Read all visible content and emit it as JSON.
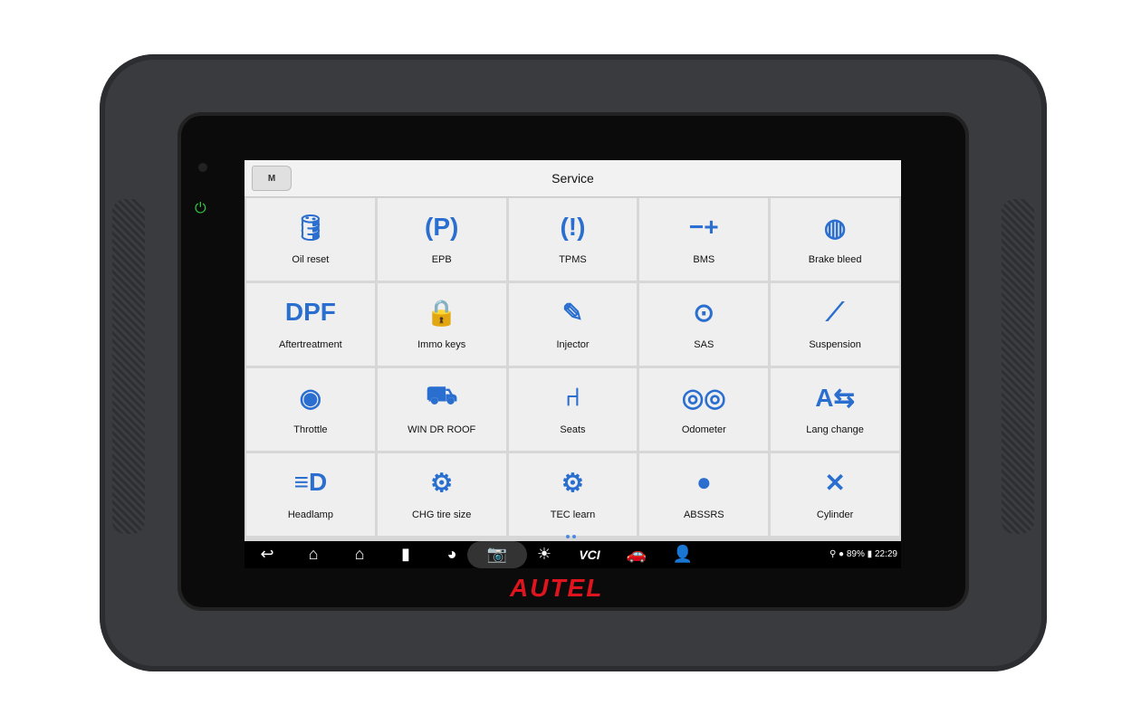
{
  "header": {
    "back_label": "M",
    "title": "Service"
  },
  "accent": "#2a6fd0",
  "tiles": [
    {
      "label": "Oil reset",
      "icon": "oil-can-icon",
      "glyph": "🛢"
    },
    {
      "label": "EPB",
      "icon": "parking-brake-icon",
      "glyph": "(P)"
    },
    {
      "label": "TPMS",
      "icon": "tire-pressure-icon",
      "glyph": "(!)"
    },
    {
      "label": "BMS",
      "icon": "battery-icon",
      "glyph": "−+"
    },
    {
      "label": "Brake bleed",
      "icon": "brake-icon",
      "glyph": "◍"
    },
    {
      "label": "Aftertreatment",
      "icon": "dpf-scr-icon",
      "glyph": "DPF"
    },
    {
      "label": "Immo keys",
      "icon": "key-lock-icon",
      "glyph": "🔒"
    },
    {
      "label": "Injector",
      "icon": "injector-icon",
      "glyph": "✎"
    },
    {
      "label": "SAS",
      "icon": "steering-wheel-icon",
      "glyph": "⊙"
    },
    {
      "label": "Suspension",
      "icon": "shock-absorber-icon",
      "glyph": "⟋"
    },
    {
      "label": "Throttle",
      "icon": "throttle-icon",
      "glyph": "◉"
    },
    {
      "label": "WIN DR ROOF",
      "icon": "car-top-icon",
      "glyph": "⛟"
    },
    {
      "label": "Seats",
      "icon": "seat-icon",
      "glyph": "⑁"
    },
    {
      "label": "Odometer",
      "icon": "odometer-icon",
      "glyph": "◎◎"
    },
    {
      "label": "Lang change",
      "icon": "language-icon",
      "glyph": "A⇆"
    },
    {
      "label": "Headlamp",
      "icon": "headlamp-icon",
      "glyph": "≡D"
    },
    {
      "label": "CHG tire size",
      "icon": "tire-icon",
      "glyph": "⚙"
    },
    {
      "label": "TEC learn",
      "icon": "gear-learn-icon",
      "glyph": "⚙"
    },
    {
      "label": "ABSSRS",
      "icon": "airbag-icon",
      "glyph": "●"
    },
    {
      "label": "Cylinder",
      "icon": "piston-icon",
      "glyph": "✕"
    }
  ],
  "navbar": {
    "buttons": [
      {
        "icon": "back-arrow-icon",
        "glyph": "↩"
      },
      {
        "icon": "home-icon",
        "glyph": "⌂"
      },
      {
        "icon": "android-home-icon",
        "glyph": "⌂"
      },
      {
        "icon": "recent-apps-icon",
        "glyph": "▮"
      },
      {
        "icon": "browser-icon",
        "glyph": "◕"
      },
      {
        "icon": "camera-icon",
        "glyph": "📷"
      },
      {
        "icon": "brightness-volume-icon",
        "glyph": "☀"
      },
      {
        "icon": "vci-icon",
        "glyph": "VCI"
      },
      {
        "icon": "car-icon",
        "glyph": "🚗"
      },
      {
        "icon": "remote-expert-icon",
        "glyph": "👤"
      }
    ],
    "battery": "89%",
    "time": "22:29"
  },
  "brand": "AUTEL"
}
